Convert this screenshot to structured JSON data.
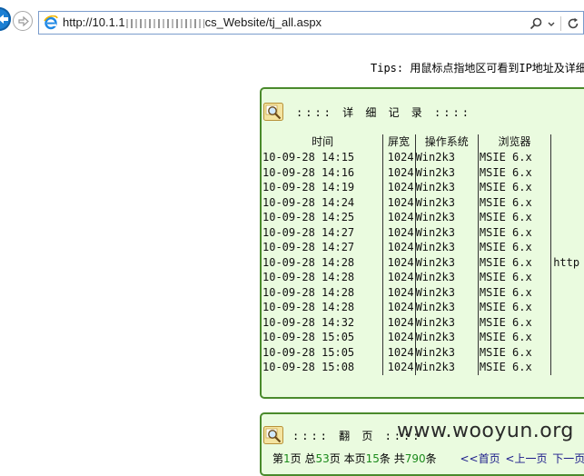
{
  "browser": {
    "url_prefix": "http://10.1.1",
    "url_suffix": "cs_Website/tj_all.aspx",
    "icons": [
      "back-icon",
      "forward-icon",
      "ie-logo-icon",
      "search-icon",
      "dropdown-icon",
      "refresh-icon"
    ]
  },
  "page": {
    "tips": "Tips: 用鼠标点指地区可看到IP地址及详细",
    "detail_title": "::::  详 细 记 录  ::::",
    "columns": {
      "time": "时间",
      "resolution": "屏宽",
      "os": "操作系统",
      "browser": "浏览器"
    },
    "records": [
      {
        "time": "10-09-28 14:15",
        "resolution": "1024",
        "os": "Win2k3",
        "browser": "MSIE 6.x",
        "ref": ""
      },
      {
        "time": "10-09-28 14:16",
        "resolution": "1024",
        "os": "Win2k3",
        "browser": "MSIE 6.x",
        "ref": ""
      },
      {
        "time": "10-09-28 14:19",
        "resolution": "1024",
        "os": "Win2k3",
        "browser": "MSIE 6.x",
        "ref": ""
      },
      {
        "time": "10-09-28 14:24",
        "resolution": "1024",
        "os": "Win2k3",
        "browser": "MSIE 6.x",
        "ref": ""
      },
      {
        "time": "10-09-28 14:25",
        "resolution": "1024",
        "os": "Win2k3",
        "browser": "MSIE 6.x",
        "ref": ""
      },
      {
        "time": "10-09-28 14:27",
        "resolution": "1024",
        "os": "Win2k3",
        "browser": "MSIE 6.x",
        "ref": ""
      },
      {
        "time": "10-09-28 14:27",
        "resolution": "1024",
        "os": "Win2k3",
        "browser": "MSIE 6.x",
        "ref": ""
      },
      {
        "time": "10-09-28 14:28",
        "resolution": "1024",
        "os": "Win2k3",
        "browser": "MSIE 6.x",
        "ref": "http"
      },
      {
        "time": "10-09-28 14:28",
        "resolution": "1024",
        "os": "Win2k3",
        "browser": "MSIE 6.x",
        "ref": ""
      },
      {
        "time": "10-09-28 14:28",
        "resolution": "1024",
        "os": "Win2k3",
        "browser": "MSIE 6.x",
        "ref": ""
      },
      {
        "time": "10-09-28 14:28",
        "resolution": "1024",
        "os": "Win2k3",
        "browser": "MSIE 6.x",
        "ref": ""
      },
      {
        "time": "10-09-28 14:32",
        "resolution": "1024",
        "os": "Win2k3",
        "browser": "MSIE 6.x",
        "ref": ""
      },
      {
        "time": "10-09-28 15:05",
        "resolution": "1024",
        "os": "Win2k3",
        "browser": "MSIE 6.x",
        "ref": ""
      },
      {
        "time": "10-09-28 15:05",
        "resolution": "1024",
        "os": "Win2k3",
        "browser": "MSIE 6.x",
        "ref": ""
      },
      {
        "time": "10-09-28 15:08",
        "resolution": "1024",
        "os": "Win2k3",
        "browser": "MSIE 6.x",
        "ref": ""
      }
    ],
    "paging_title": "::::  翻  页  ::::",
    "paging": {
      "page_prefix": "第",
      "current_page": "1",
      "page_label": "页 总",
      "total_pages": "53",
      "total_label": "页 本页",
      "per_page": "15",
      "per_page_label": "条 共",
      "total_records": "790",
      "records_label": "条",
      "first": "<<首页",
      "prev": "<上一页",
      "next": "下一页>"
    },
    "watermark": "www.wooyun.org"
  },
  "colors": {
    "panel_bg": "#eafbdf",
    "panel_border": "#4a8a2c",
    "number_highlight": "#1a8a1a"
  }
}
